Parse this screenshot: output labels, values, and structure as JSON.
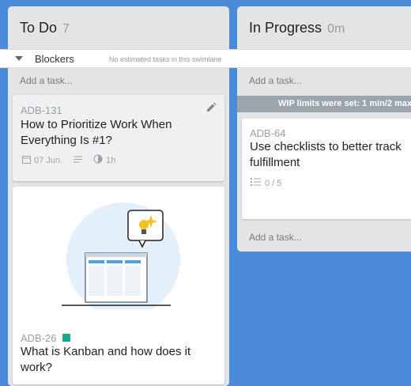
{
  "columns": [
    {
      "title": "To Do",
      "count": "7",
      "add_task": "Add a task..."
    },
    {
      "title": "In Progress",
      "count": "0m",
      "add_task_top": "Add a task...",
      "add_task_bottom": "Add a task..."
    }
  ],
  "swimlane": {
    "name": "Blockers",
    "note": "No estimated tasks in this swimlane"
  },
  "wip_banner": "WIP limits were set: 1 min/2 max",
  "cards": {
    "adb131": {
      "id": "ADB-131",
      "title_line1": "How to Prioritize Work When",
      "title_line2": "Everything Is #1?",
      "date": "07 Jun.",
      "time": "1h"
    },
    "adb26": {
      "id": "ADB-26",
      "title_line1": "What is Kanban and how does it",
      "title_line2": "work?"
    },
    "adb64": {
      "id": "ADB-64",
      "title_line1": "Use checklists to better track",
      "title_line2": "fulfillment",
      "checklist": "0 / 5"
    }
  },
  "colors": {
    "board_bg": "#4a8ad6",
    "column_bg": "#e2e4e6",
    "tag_green": "#16a889",
    "wip_bg": "#9aa5ad"
  }
}
